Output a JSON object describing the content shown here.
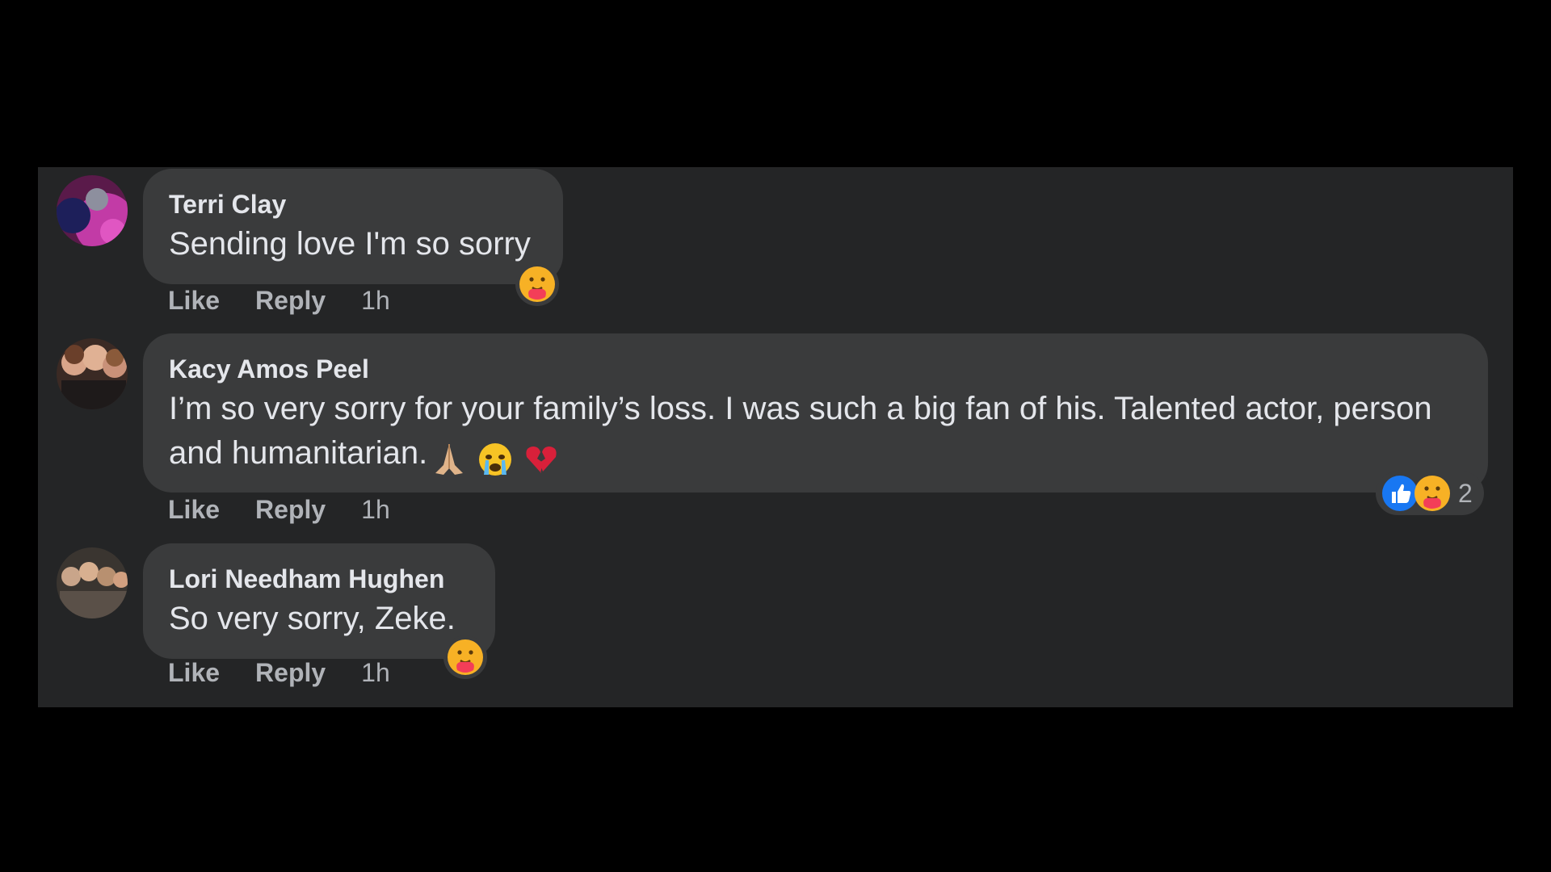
{
  "comments": [
    {
      "author": "Terri Clay",
      "text": "Sending love I'm so sorry",
      "actions": {
        "like": "Like",
        "reply": "Reply",
        "time": "1h"
      },
      "reaction_icons": [
        "care-reaction-icon"
      ]
    },
    {
      "author": "Kacy Amos Peel",
      "text_line1": "I’m so very sorry for your family’s loss. I was such a big fan of his. Talented actor, person",
      "text_line2": "and humanitarian.",
      "inline_emojis": [
        "folded-hands-icon",
        "crying-face-icon",
        "broken-heart-icon"
      ],
      "actions": {
        "like": "Like",
        "reply": "Reply",
        "time": "1h"
      },
      "reaction_icons": [
        "like-reaction-icon",
        "care-reaction-icon"
      ],
      "reaction_count": "2"
    },
    {
      "author": "Lori Needham Hughen",
      "text": "So very sorry, Zeke.",
      "actions": {
        "like": "Like",
        "reply": "Reply",
        "time": "1h"
      },
      "reaction_icons": [
        "care-reaction-icon"
      ]
    }
  ],
  "colors": {
    "page_background": "#000000",
    "panel_background": "#242526",
    "bubble_background": "#3a3b3c",
    "primary_text": "#e4e6eb",
    "secondary_text": "#b0b3b8",
    "like_blue": "#1877f2"
  }
}
